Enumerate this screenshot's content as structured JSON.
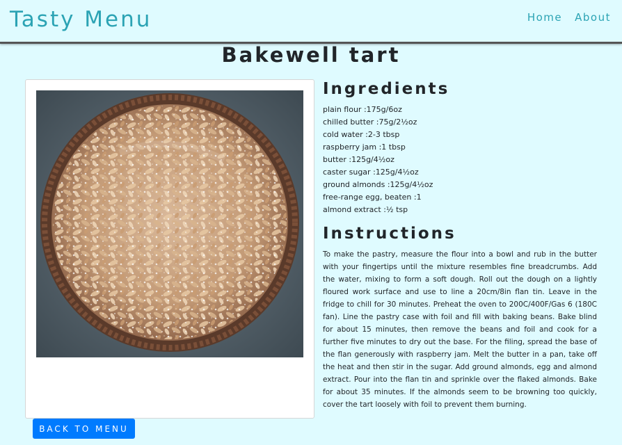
{
  "header": {
    "brand": "Tasty Menu",
    "nav": {
      "home": "Home",
      "about": "About"
    }
  },
  "recipe": {
    "title": "Bakewell tart",
    "image_subject": "bakewell-tart-photo",
    "ingredients_heading": "Ingredients",
    "ingredients": [
      "plain flour :175g/6oz",
      "chilled butter :75g/2½oz",
      "cold water :2-3 tbsp",
      "raspberry jam :1 tbsp",
      "butter :125g/4½oz",
      "caster sugar :125g/4½oz",
      "ground almonds :125g/4½oz",
      "free-range egg, beaten :1",
      "almond extract :½ tsp"
    ],
    "instructions_heading": "Instructions",
    "instructions": "To make the pastry, measure the flour into a bowl and rub in the butter with your fingertips until the mixture resembles fine breadcrumbs. Add the water, mixing to form a soft dough. Roll out the dough on a lightly floured work surface and use to line a 20cm/8in flan tin. Leave in the fridge to chill for 30 minutes. Preheat the oven to 200C/400F/Gas 6 (180C fan). Line the pastry case with foil and fill with baking beans. Bake blind for about 15 minutes, then remove the beans and foil and cook for a further five minutes to dry out the base. For the filing, spread the base of the flan generously with raspberry jam. Melt the butter in a pan, take off the heat and then stir in the sugar. Add ground almonds, egg and almond extract. Pour into the flan tin and sprinkle over the flaked almonds. Bake for about 35 minutes. If the almonds seem to be browning too quickly, cover the tart loosely with foil to prevent them burning."
  },
  "actions": {
    "back": "BACK TO MENU"
  },
  "colors": {
    "background": "#dffbff",
    "brand": "#2ba3b4",
    "button": "#007bff",
    "text": "#212529"
  }
}
